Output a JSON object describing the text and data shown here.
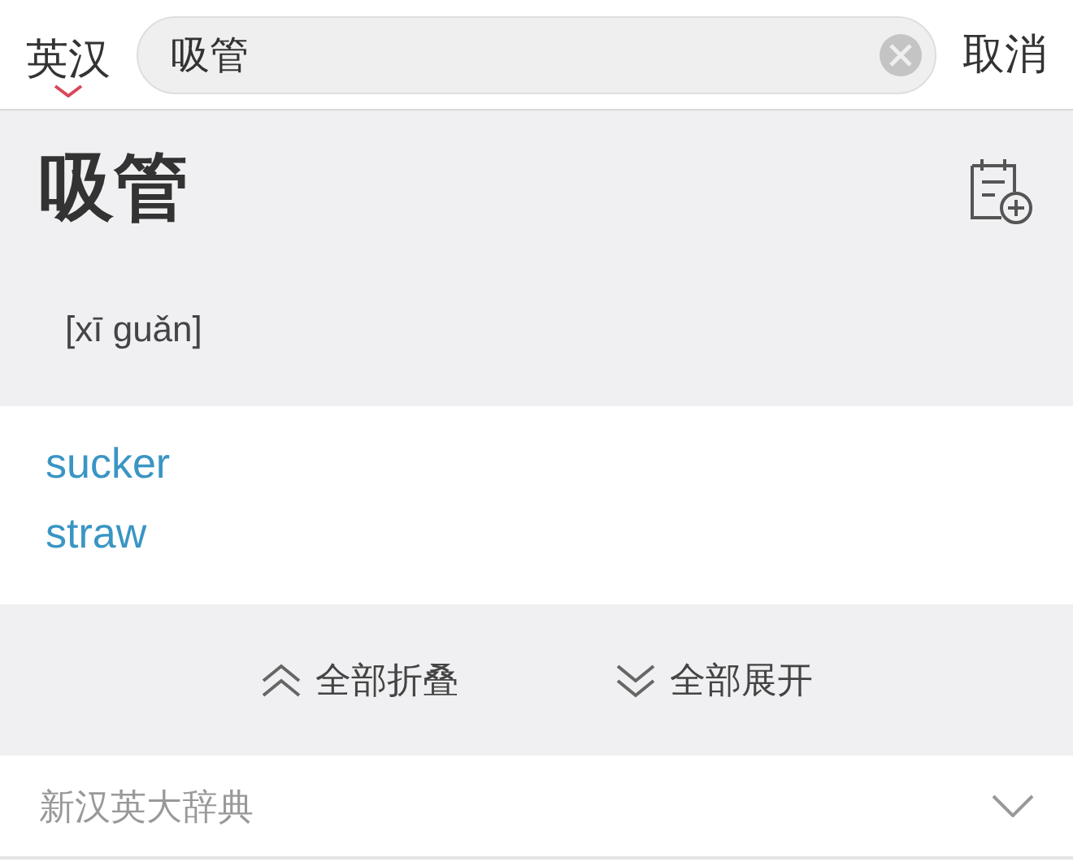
{
  "header": {
    "language": "英汉",
    "search": {
      "value": "吸管"
    },
    "cancel": "取消"
  },
  "entry": {
    "headword": "吸管",
    "pinyin": "[xī guǎn]"
  },
  "definitions": [
    "sucker",
    "straw"
  ],
  "actions": [
    {
      "kind": "collapse",
      "label": "全部折叠"
    },
    {
      "kind": "expand",
      "label": "全部展开"
    }
  ],
  "dictionaries": [
    {
      "name": "新汉英大辞典",
      "expanded": false
    }
  ]
}
